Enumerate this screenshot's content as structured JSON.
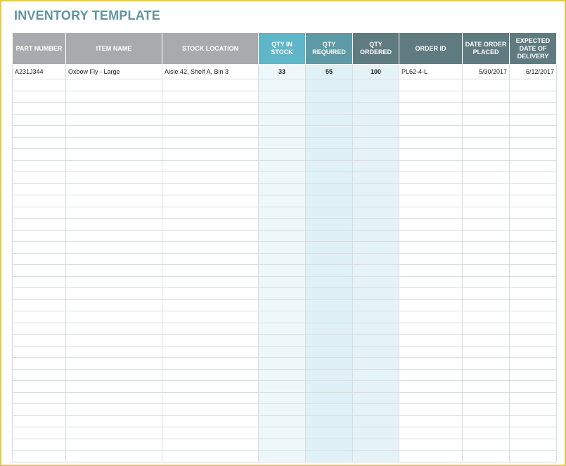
{
  "title": "INVENTORY TEMPLATE",
  "columns": [
    "PART NUMBER",
    "ITEM NAME",
    "STOCK LOCATION",
    "QTY IN STOCK",
    "QTY REQUIRED",
    "QTY ORDERED",
    "ORDER ID",
    "DATE ORDER PLACED",
    "EXPECTED DATE OF DELIVERY"
  ],
  "rows": [
    {
      "part_number": "A231J344",
      "item_name": "Oxbow Fly - Large",
      "stock_location": "Aisle 42, Shelf A, Bin 3",
      "qty_in_stock": "33",
      "qty_required": "55",
      "qty_ordered": "100",
      "order_id": "PL62-4-L",
      "date_order_placed": "5/30/2017",
      "expected_delivery": "6/12/2017"
    }
  ],
  "colors": {
    "title": "#5f94a3",
    "header_gray": "#a7abad",
    "header_light_teal": "#5fb6c8",
    "header_teal": "#5e9aa6",
    "header_slate": "#5f7b80",
    "frame": "#e3c84a"
  }
}
